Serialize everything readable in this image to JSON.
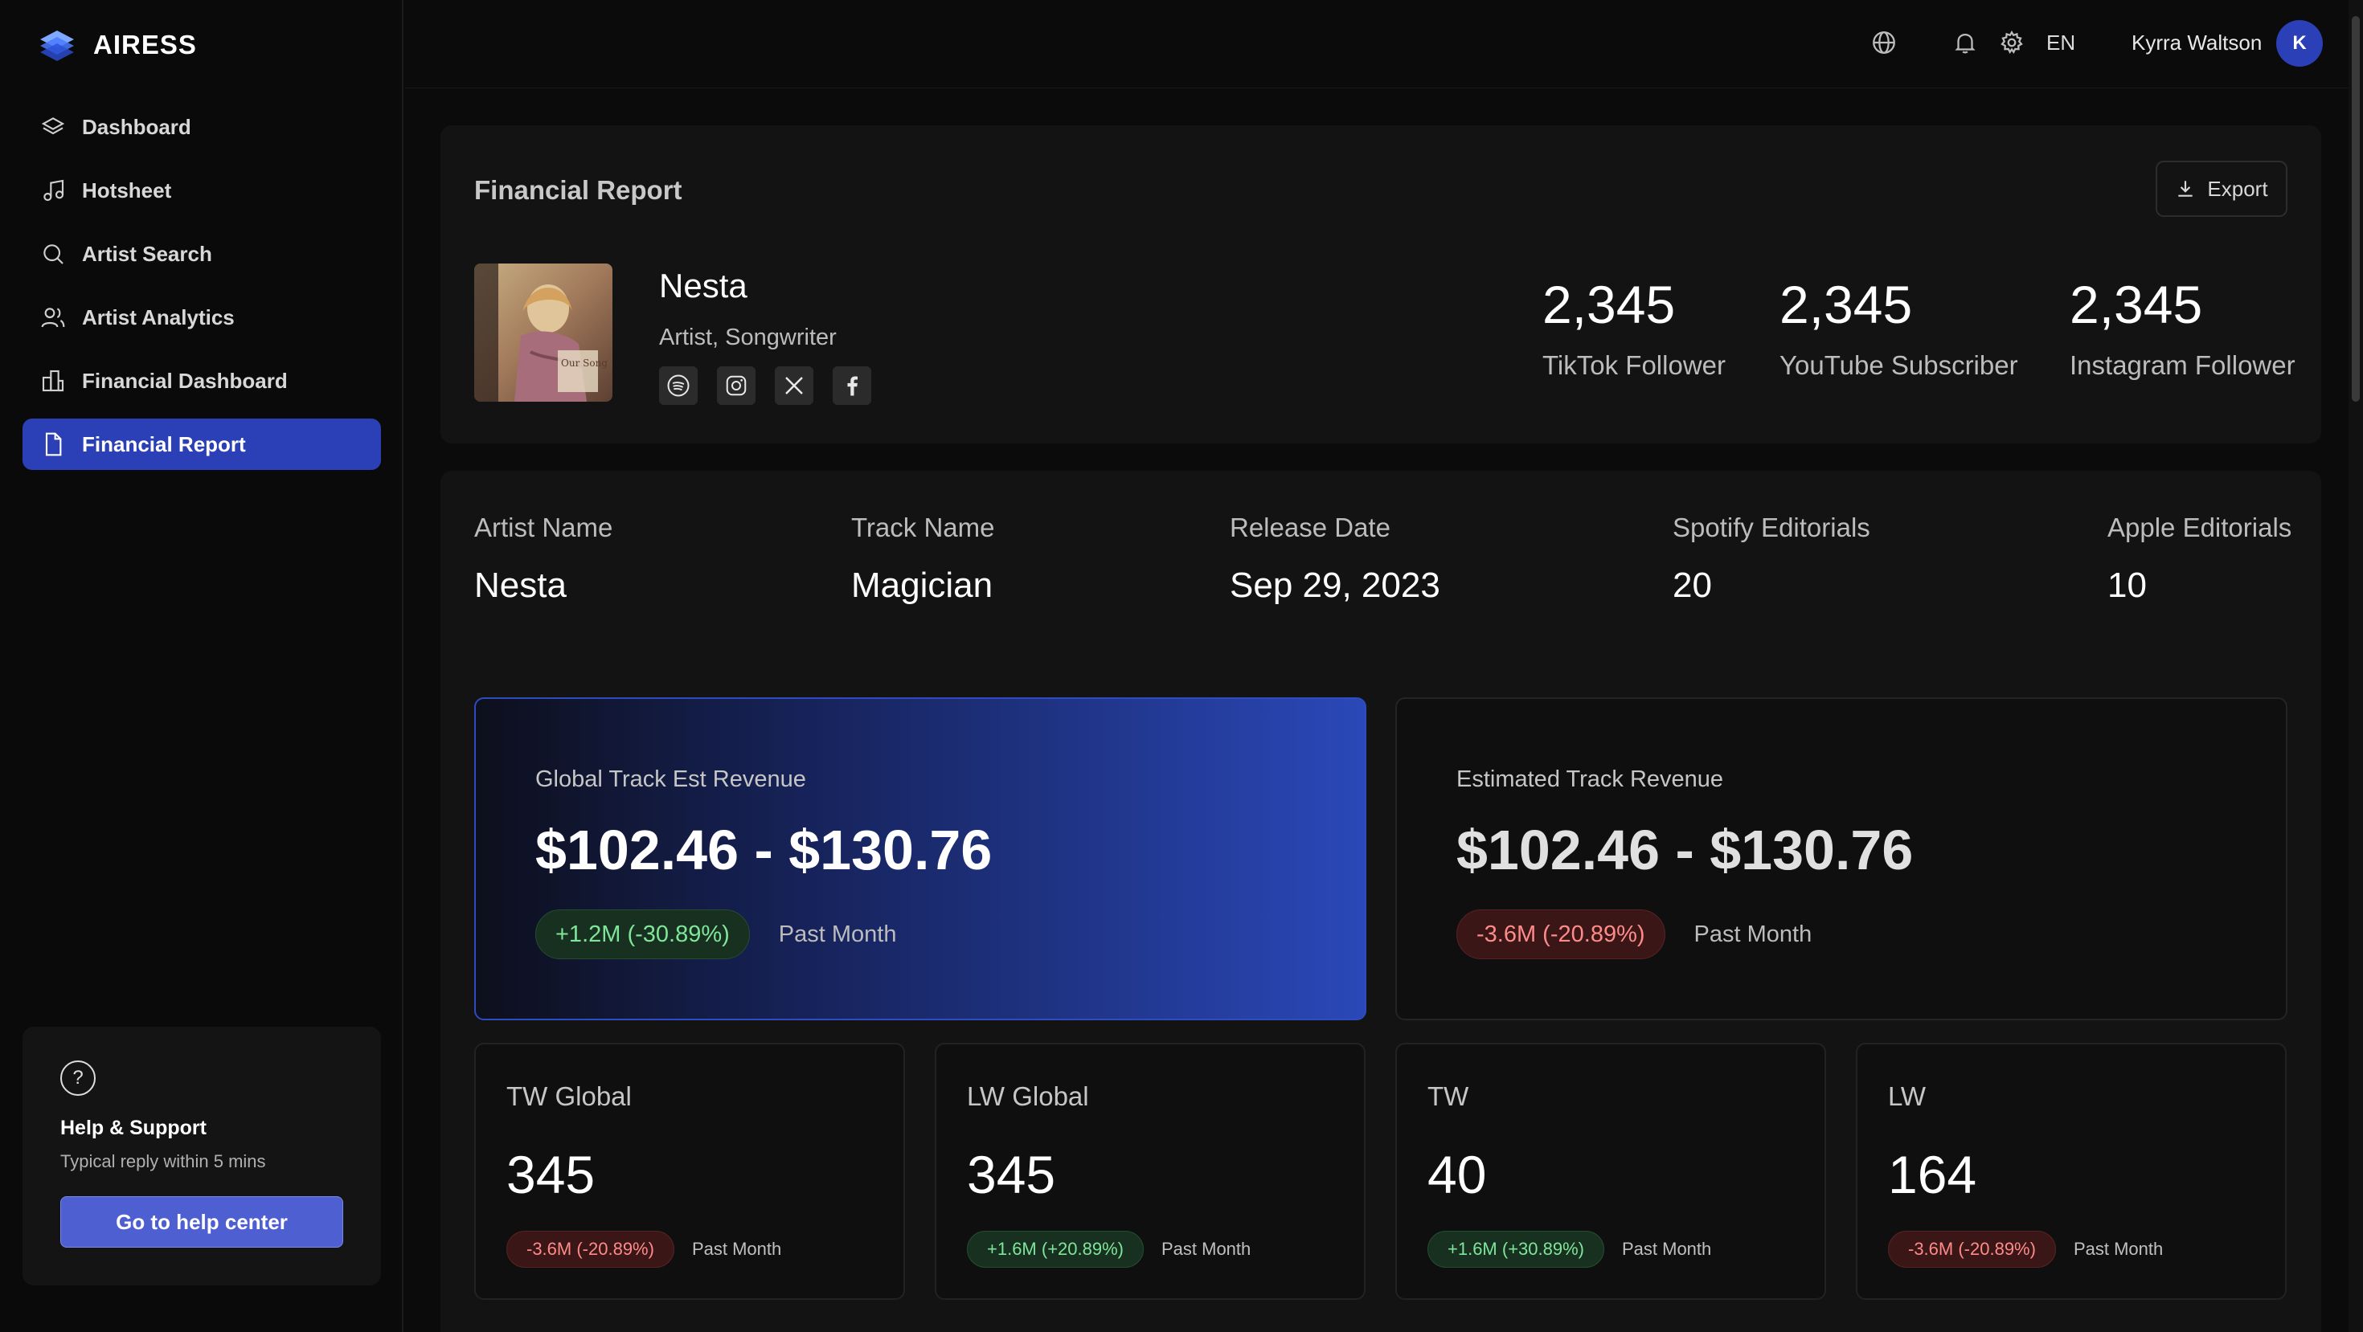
{
  "brand": {
    "name": "AIRESS"
  },
  "sidebar": {
    "items": [
      {
        "label": "Dashboard",
        "icon": "layers-icon"
      },
      {
        "label": "Hotsheet",
        "icon": "music-note-icon"
      },
      {
        "label": "Artist Search",
        "icon": "search-icon"
      },
      {
        "label": "Artist Analytics",
        "icon": "users-icon"
      },
      {
        "label": "Financial Dashboard",
        "icon": "buildings-icon"
      },
      {
        "label": "Financial Report",
        "icon": "document-icon",
        "active": true
      }
    ]
  },
  "help": {
    "title": "Help & Support",
    "subtitle": "Typical reply within 5 mins",
    "button": "Go to help center"
  },
  "topbar": {
    "language": "EN",
    "user_name": "Kyrra Waltson",
    "avatar_initial": "K"
  },
  "report": {
    "title": "Financial Report",
    "export_label": "Export",
    "artist": {
      "name": "Nesta",
      "role": "Artist, Songwriter",
      "cover_text": "Our Song"
    },
    "stats": [
      {
        "value": "2,345",
        "label": "TikTok Follower"
      },
      {
        "value": "2,345",
        "label": "YouTube Subscriber"
      },
      {
        "value": "2,345",
        "label": "Instagram Follower"
      }
    ]
  },
  "details": {
    "fields": [
      {
        "label": "Artist Name",
        "value": "Nesta"
      },
      {
        "label": "Track Name",
        "value": "Magician"
      },
      {
        "label": "Release Date",
        "value": "Sep 29, 2023"
      },
      {
        "label": "Spotify Editorials",
        "value": "20"
      },
      {
        "label": "Apple Editorials",
        "value": "10"
      }
    ]
  },
  "revenue": [
    {
      "label": "Global Track Est Revenue",
      "value": "$102.46 - $130.76",
      "change": "+1.2M (-30.89%)",
      "trend": "positive",
      "period": "Past Month"
    },
    {
      "label": "Estimated Track Revenue",
      "value": "$102.46 - $130.76",
      "change": "-3.6M (-20.89%)",
      "trend": "negative",
      "period": "Past Month"
    }
  ],
  "metrics": [
    {
      "label": "TW Global",
      "value": "345",
      "change": "-3.6M (-20.89%)",
      "trend": "negative",
      "period": "Past Month"
    },
    {
      "label": "LW Global",
      "value": "345",
      "change": "+1.6M (+20.89%)",
      "trend": "positive",
      "period": "Past Month"
    },
    {
      "label": "TW",
      "value": "40",
      "change": "+1.6M (+30.89%)",
      "trend": "positive",
      "period": "Past Month"
    },
    {
      "label": "LW",
      "value": "164",
      "change": "-3.6M (-20.89%)",
      "trend": "negative",
      "period": "Past Month"
    }
  ],
  "colors": {
    "accent": "#2b3fb6",
    "positive": "#7fe59a",
    "negative": "#ff8a8a"
  }
}
